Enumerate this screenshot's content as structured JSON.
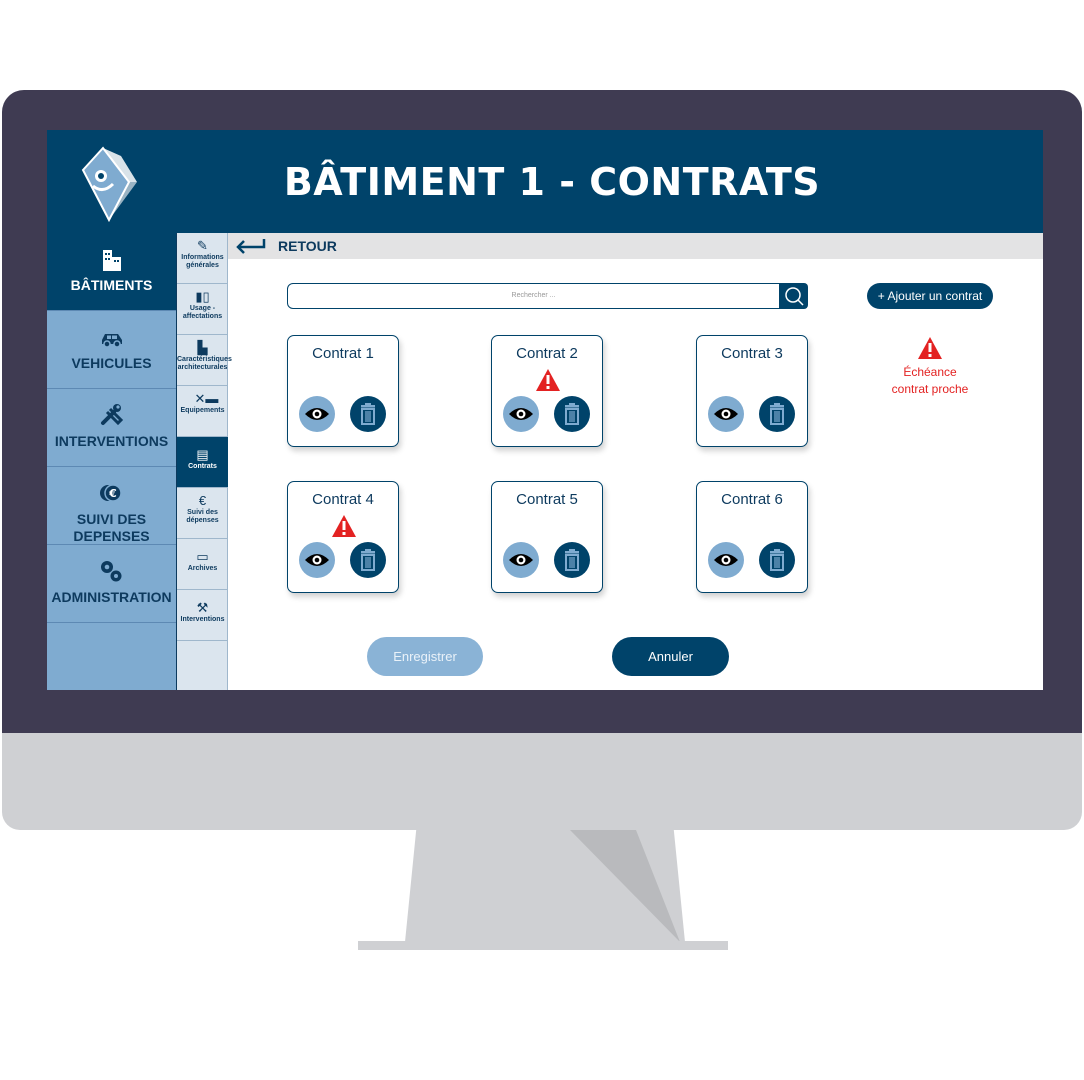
{
  "header": {
    "title": "BÂTIMENT 1 - CONTRATS"
  },
  "sidebar": {
    "items": [
      {
        "label": "BÂTIMENTS",
        "icon": "building-icon",
        "active": true
      },
      {
        "label": "VEHICULES",
        "icon": "car-icon",
        "active": false
      },
      {
        "label": "INTERVENTIONS",
        "icon": "tools-icon",
        "active": false
      },
      {
        "label": "SUIVI DES DEPENSES",
        "icon": "euro-coins-icon",
        "active": false
      },
      {
        "label": "ADMINISTRATION",
        "icon": "gears-icon",
        "active": false
      }
    ]
  },
  "subnav": {
    "items": [
      {
        "label": "Informations générales",
        "icon": "edit-doc-icon"
      },
      {
        "label": "Usage - affectations",
        "icon": "usage-icon"
      },
      {
        "label": "Caractéristiques architecturales",
        "icon": "building-icon"
      },
      {
        "label": "Equipements",
        "icon": "equipment-icon"
      },
      {
        "label": "Contrats",
        "icon": "contract-icon",
        "active": true
      },
      {
        "label": "Suivi des dépenses",
        "icon": "euro-coins-icon"
      },
      {
        "label": "Archives",
        "icon": "folder-icon"
      },
      {
        "label": "Interventions",
        "icon": "tools-icon"
      }
    ]
  },
  "nav": {
    "back_label": "RETOUR"
  },
  "search": {
    "placeholder": "Rechercher ..."
  },
  "actions": {
    "add_contract": "+ Ajouter un contrat",
    "save": "Enregistrer",
    "cancel": "Annuler"
  },
  "legend": {
    "line1": "Échéance",
    "line2": "contrat proche"
  },
  "contracts": [
    {
      "name": "Contrat 1",
      "warning": false
    },
    {
      "name": "Contrat 2",
      "warning": true
    },
    {
      "name": "Contrat 3",
      "warning": false
    },
    {
      "name": "Contrat 4",
      "warning": true
    },
    {
      "name": "Contrat 5",
      "warning": false
    },
    {
      "name": "Contrat 6",
      "warning": false
    }
  ],
  "colors": {
    "primary": "#00436a",
    "secondary": "#7fabd0",
    "warning": "#e32222"
  }
}
